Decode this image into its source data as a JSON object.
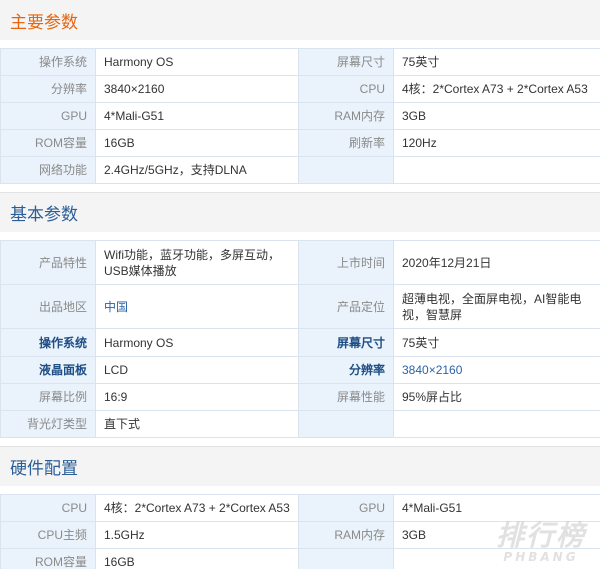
{
  "sections": [
    {
      "title": "主要参数",
      "rows": [
        {
          "k1": "操作系统",
          "v1": "Harmony OS",
          "k2": "屏幕尺寸",
          "v2": "75英寸"
        },
        {
          "k1": "分辨率",
          "v1": "3840×2160",
          "k2": "CPU",
          "v2": "4核：2*Cortex A73 + 2*Cortex A53"
        },
        {
          "k1": "GPU",
          "v1": "4*Mali-G51",
          "k2": "RAM内存",
          "v2": "3GB"
        },
        {
          "k1": "ROM容量",
          "v1": "16GB",
          "k2": "刷新率",
          "v2": "120Hz"
        },
        {
          "k1": "网络功能",
          "v1": "2.4GHz/5GHz，支持DLNA",
          "k2": "",
          "v2": ""
        }
      ]
    },
    {
      "title": "基本参数",
      "rows": [
        {
          "k1": "产品特性",
          "v1": "Wifi功能，蓝牙功能，多屏互动，USB媒体播放",
          "k2": "上市时间",
          "v2": "2020年12月21日"
        },
        {
          "k1": "出品地区",
          "v1": "中国",
          "k2": "产品定位",
          "v2": "超薄电视，全面屏电视，AI智能电视，智慧屏"
        },
        {
          "k1": "操作系统",
          "v1": "Harmony OS",
          "k2": "屏幕尺寸",
          "v2": "75英寸"
        },
        {
          "k1": "液晶面板",
          "v1": "LCD",
          "k2": "分辨率",
          "v2": "3840×2160"
        },
        {
          "k1": "屏幕比例",
          "v1": "16:9",
          "k2": "屏幕性能",
          "v2": "95%屏占比"
        },
        {
          "k1": "背光灯类型",
          "v1": "直下式",
          "k2": "",
          "v2": ""
        }
      ]
    },
    {
      "title": "硬件配置",
      "rows": [
        {
          "k1": "CPU",
          "v1": "4核：2*Cortex A73 + 2*Cortex A53",
          "k2": "GPU",
          "v2": "4*Mali-G51"
        },
        {
          "k1": "CPU主频",
          "v1": "1.5GHz",
          "k2": "RAM内存",
          "v2": "3GB"
        },
        {
          "k1": "ROM容量",
          "v1": "16GB",
          "k2": "",
          "v2": ""
        }
      ]
    }
  ],
  "watermark": {
    "cn": "排行榜",
    "en": "PHBANG"
  },
  "colors": {
    "orange_title": "#e6660f",
    "blue_title": "#2a5e99",
    "key_bg": "#eaf3fb",
    "link": "#2a63a8"
  }
}
